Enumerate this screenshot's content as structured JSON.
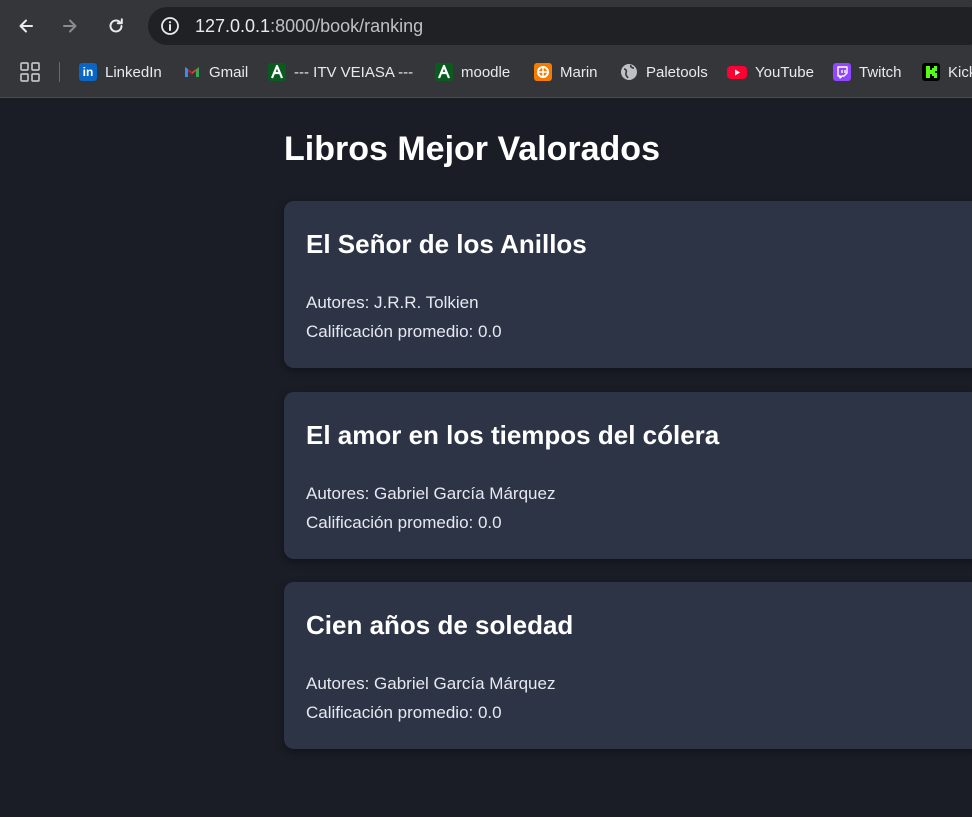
{
  "browser": {
    "url_host": "127.0.0.1",
    "url_rest": ":8000/book/ranking",
    "bookmarks": [
      {
        "label": "LinkedIn",
        "icon": "linkedin-icon",
        "color": "#0a66c2"
      },
      {
        "label": "Gmail",
        "icon": "gmail-icon",
        "color": "#ea4335"
      },
      {
        "label": "--- ITV VEIASA ---",
        "icon": "itv-icon",
        "color": "#1e8e3e"
      },
      {
        "label": "moodle",
        "icon": "moodle-icon",
        "color": "#1e8e3e"
      },
      {
        "label": "Marin",
        "icon": "marin-icon",
        "color": "#f57c00"
      },
      {
        "label": "Paletools",
        "icon": "globe-icon",
        "color": "#bdc1c6"
      },
      {
        "label": "YouTube",
        "icon": "youtube-icon",
        "color": "#ff0033"
      },
      {
        "label": "Twitch",
        "icon": "twitch-icon",
        "color": "#9146ff"
      },
      {
        "label": "Kick",
        "icon": "kick-icon",
        "color": "#53fc18"
      }
    ]
  },
  "page": {
    "title": "Libros Mejor Valorados",
    "books": [
      {
        "title": "El Señor de los Anillos",
        "authors": "Autores: J.R.R. Tolkien",
        "rating": "Calificación promedio: 0.0"
      },
      {
        "title": "El amor en los tiempos del cólera",
        "authors": "Autores: Gabriel García Márquez",
        "rating": "Calificación promedio: 0.0"
      },
      {
        "title": "Cien años de soledad",
        "authors": "Autores: Gabriel García Márquez",
        "rating": "Calificación promedio: 0.0"
      }
    ]
  }
}
